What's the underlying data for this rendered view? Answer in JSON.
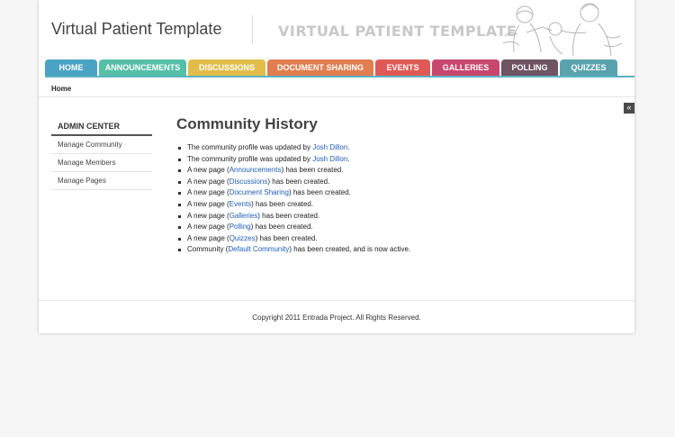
{
  "header": {
    "site_title": "Virtual Patient Template",
    "logo_text": "Virtual Patient Template",
    "illustration_icon": "physicians-engraving"
  },
  "tabs": [
    {
      "label": "HOME",
      "color": "#4aa3c3"
    },
    {
      "label": "ANNOUNCEMENTS",
      "color": "#56bfa7"
    },
    {
      "label": "DISCUSSIONS",
      "color": "#e2bd4b"
    },
    {
      "label": "DOCUMENT SHARING",
      "color": "#e07e50"
    },
    {
      "label": "EVENTS",
      "color": "#df5a56"
    },
    {
      "label": "GALLERIES",
      "color": "#c8476f"
    },
    {
      "label": "POLLING",
      "color": "#6e5363"
    },
    {
      "label": "QUIZZES",
      "color": "#5aa3ae"
    }
  ],
  "breadcrumb": "Home",
  "collapse_icon": "«",
  "sidebar": {
    "title": "ADMIN CENTER",
    "links": [
      "Manage Community",
      "Manage Members",
      "Manage Pages"
    ]
  },
  "main": {
    "heading": "Community History",
    "items": [
      {
        "before": "The community profile was updated by ",
        "link": "Josh Dillon",
        "after": "."
      },
      {
        "before": "The community profile was updated by ",
        "link": "Josh Dillon",
        "after": "."
      },
      {
        "before": "A new page (",
        "link": "Announcements",
        "after": ") has been created."
      },
      {
        "before": "A new page (",
        "link": "Discussions",
        "after": ") has been created."
      },
      {
        "before": "A new page (",
        "link": "Document Sharing",
        "after": ") has been created."
      },
      {
        "before": "A new page (",
        "link": "Events",
        "after": ") has been created."
      },
      {
        "before": "A new page (",
        "link": "Galleries",
        "after": ") has been created."
      },
      {
        "before": "A new page (",
        "link": "Polling",
        "after": ") has been created."
      },
      {
        "before": "A new page (",
        "link": "Quizzes",
        "after": ") has been created."
      },
      {
        "before": "Community (",
        "link": "Default Community",
        "after": ") has been created, and is now active."
      }
    ]
  },
  "footer": "Copyright 2011 Entrada Project. All Rights Reserved."
}
